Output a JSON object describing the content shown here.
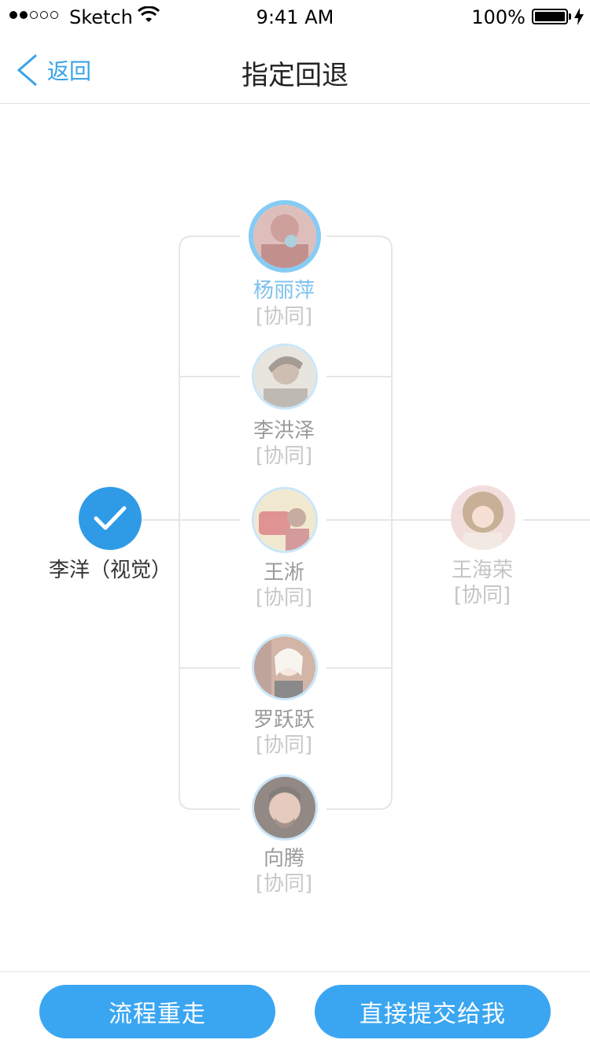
{
  "status_bar": {
    "carrier": "Sketch",
    "time": "9:41 AM",
    "battery": "100%"
  },
  "nav": {
    "back_label": "返回",
    "title": "指定回退"
  },
  "flow": {
    "start": {
      "label": "李洋（视觉）",
      "icon": "check-icon"
    },
    "branch": [
      {
        "name": "杨丽萍",
        "role": "[协同]",
        "selected": true
      },
      {
        "name": "李洪泽",
        "role": "[协同]",
        "selected": false
      },
      {
        "name": "王淅",
        "role": "[协同]",
        "selected": false
      },
      {
        "name": "罗跃跃",
        "role": "[协同]",
        "selected": false
      },
      {
        "name": "向腾",
        "role": "[协同]",
        "selected": false
      }
    ],
    "next": {
      "name": "王海荣",
      "role": "[协同]"
    }
  },
  "actions": {
    "redo_label": "流程重走",
    "submit_label": "直接提交给我"
  },
  "colors": {
    "accent": "#3aa6f2",
    "highlight": "#7cc1ee",
    "line": "#e6e6e6"
  }
}
